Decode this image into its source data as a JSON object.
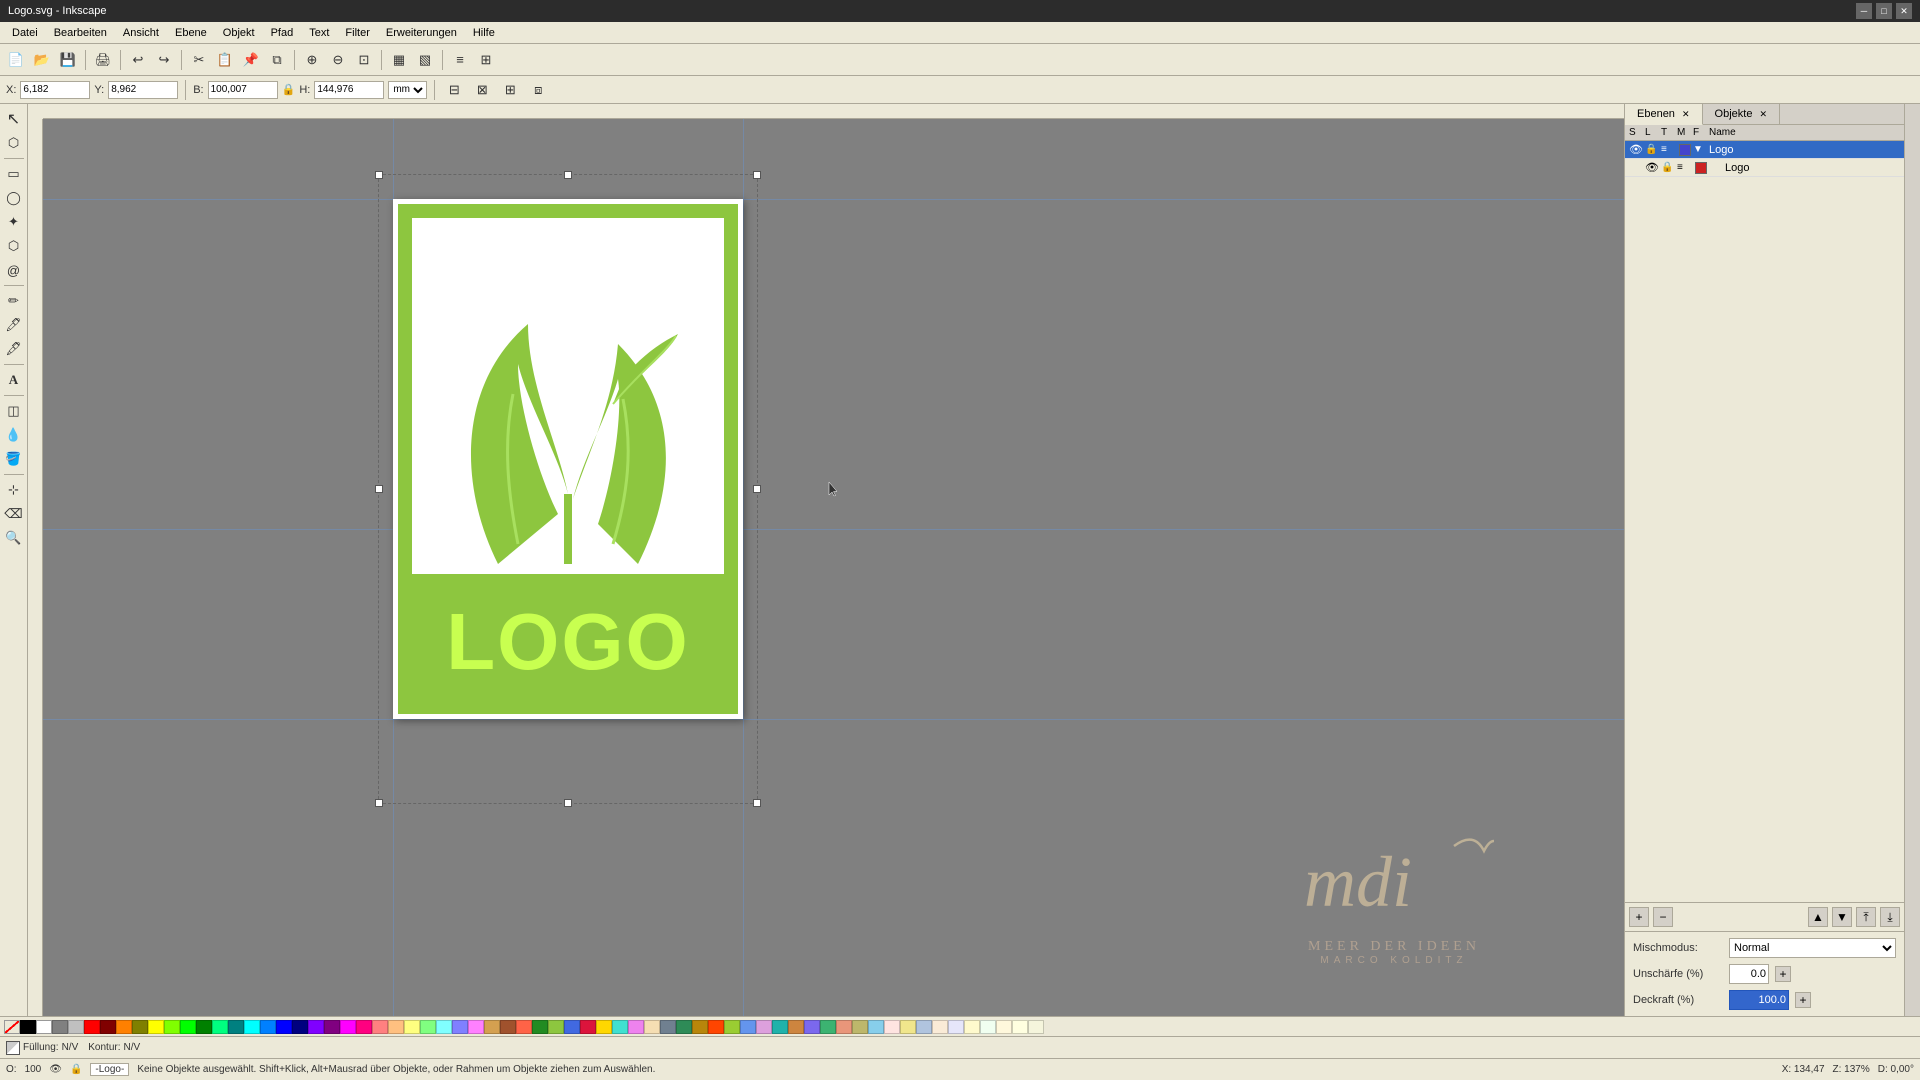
{
  "window": {
    "title": "Logo.svg - Inkscape",
    "controls": [
      "minimize",
      "maximize",
      "close"
    ]
  },
  "menu": {
    "items": [
      "Datei",
      "Bearbeiten",
      "Ansicht",
      "Ebene",
      "Objekt",
      "Pfad",
      "Text",
      "Filter",
      "Erweiterungen",
      "Hilfe"
    ]
  },
  "controls_bar": {
    "x_label": "X",
    "x_value": "6,182",
    "y_label": "Y",
    "y_value": "8,962",
    "b_label": "B:",
    "b_value": "100,007",
    "h_label": "H:",
    "h_value": "144,976",
    "unit": "mm"
  },
  "layers_panel": {
    "tab_ebenen": "Ebenen",
    "tab_objekte": "Objekte",
    "header_cols": [
      "S",
      "L",
      "T",
      "M",
      "F",
      "Name"
    ],
    "layers": [
      {
        "id": 1,
        "name": "Logo",
        "visible": true,
        "locked": false,
        "selected": true,
        "color": "#4444cc",
        "has_children": true,
        "expanded": true
      },
      {
        "id": 2,
        "name": "Logo",
        "visible": true,
        "locked": false,
        "selected": false,
        "color": "#cc2222",
        "has_children": false,
        "indent": true
      }
    ],
    "add_btn": "+",
    "remove_btn": "−"
  },
  "blend_section": {
    "mischmodus_label": "Mischmodus:",
    "mischmodus_value": "Normal",
    "unschaerfe_label": "Unschärfe (%)",
    "unschaerfe_value": "0.0",
    "deckraft_label": "Deckraft (%)",
    "deckraft_value": "100.0"
  },
  "status_bar": {
    "fill_label": "Füllung:",
    "fill_value": "N/V",
    "stroke_label": "Kontur:",
    "stroke_value": "N/V",
    "opacity_label": "O:",
    "opacity_value": "100",
    "layer_label": "-Logo-",
    "message": "Keine Objekte ausgewählt. Shift+Klick, Alt+Mausrad über Objekte, oder Rahmen um Objekte ziehen zum Auswählen.",
    "x_coord": "X: 134,47",
    "zoom": "Z: 137%",
    "rotation": "D: 0,00°"
  },
  "canvas": {
    "background_color": "#808080",
    "artboard_color": "#ffffff"
  },
  "logo": {
    "border_color": "#8dc63f",
    "text": "LOGO",
    "text_color": "#8dc63f",
    "leaf_color": "#8dc63f"
  },
  "watermark": {
    "script": "mdi",
    "brand_name": "MEER DER IDEEN",
    "brand_sub": "MARCO KOLDITZ"
  },
  "palette_colors": [
    "#000000",
    "#ffffff",
    "#808080",
    "#c0c0c0",
    "#ff0000",
    "#800000",
    "#ff8000",
    "#808000",
    "#ffff00",
    "#80ff00",
    "#00ff00",
    "#008000",
    "#00ff80",
    "#008080",
    "#00ffff",
    "#0080ff",
    "#0000ff",
    "#000080",
    "#8000ff",
    "#800080",
    "#ff00ff",
    "#ff0080",
    "#ff8080",
    "#ffc080",
    "#ffff80",
    "#80ff80",
    "#80ffff",
    "#8080ff",
    "#ff80ff",
    "#d4a050",
    "#a0522d",
    "#ff6347"
  ]
}
